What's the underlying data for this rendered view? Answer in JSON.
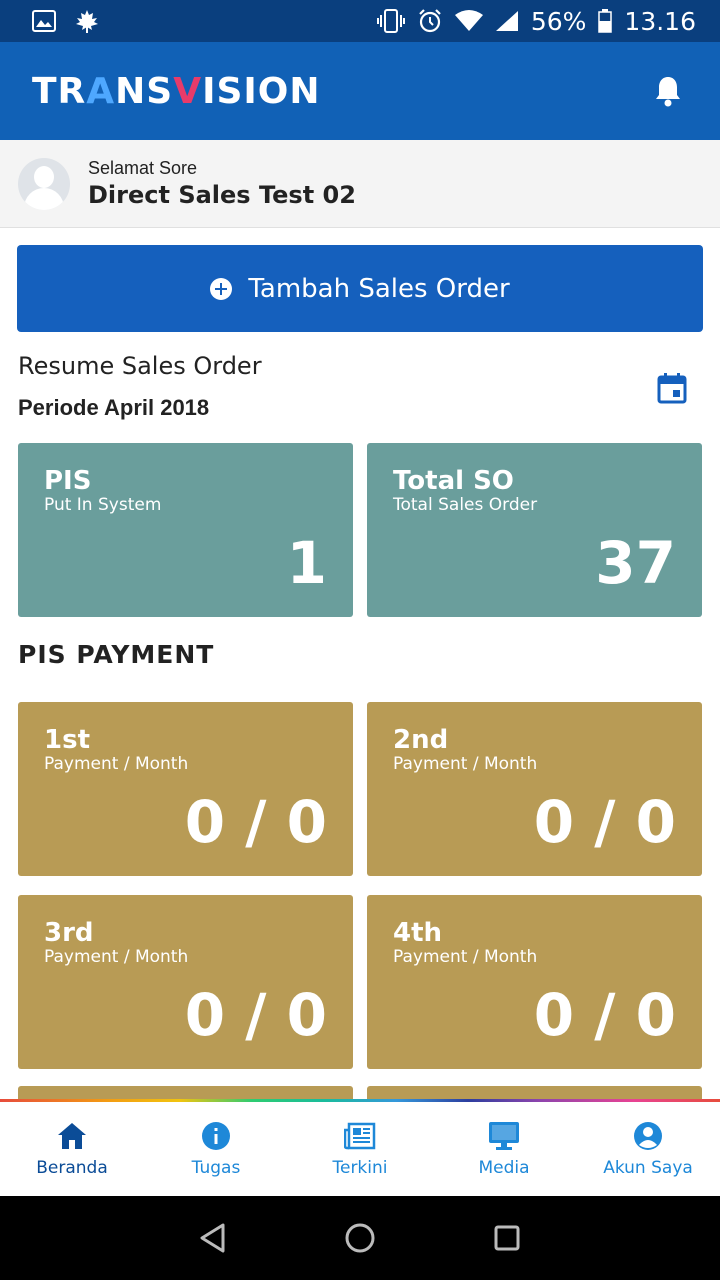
{
  "status_bar": {
    "battery": "56%",
    "time": "13.16"
  },
  "app_bar": {
    "logo": {
      "part1": "TR",
      "part2": "A",
      "part3": "NS",
      "part4": "V",
      "part5": "ISION"
    },
    "icon": "bell-icon"
  },
  "greeting": {
    "salutation": "Selamat Sore",
    "name": "Direct Sales Test 02"
  },
  "add_button": {
    "label": "Tambah Sales Order"
  },
  "resume": {
    "title": "Resume Sales Order",
    "periode": "Periode April 2018"
  },
  "summary_cards": [
    {
      "title": "PIS",
      "subtitle": "Put In System",
      "value": "1"
    },
    {
      "title": "Total SO",
      "subtitle": "Total Sales Order",
      "value": "37"
    }
  ],
  "pis_payment": {
    "title": "PIS PAYMENT",
    "cards": [
      {
        "title": "1st",
        "subtitle": "Payment / Month",
        "value": "0 / 0"
      },
      {
        "title": "2nd",
        "subtitle": "Payment / Month",
        "value": "0 / 0"
      },
      {
        "title": "3rd",
        "subtitle": "Payment / Month",
        "value": "0 / 0"
      },
      {
        "title": "4th",
        "subtitle": "Payment / Month",
        "value": "0 / 0"
      }
    ]
  },
  "bottom_nav": [
    {
      "label": "Beranda",
      "icon": "home-icon",
      "active": true
    },
    {
      "label": "Tugas",
      "icon": "info-icon",
      "active": false
    },
    {
      "label": "Terkini",
      "icon": "newspaper-icon",
      "active": false
    },
    {
      "label": "Media",
      "icon": "monitor-icon",
      "active": false
    },
    {
      "label": "Akun Saya",
      "icon": "account-icon",
      "active": false
    }
  ],
  "colors": {
    "status_bar": "#0a3f7e",
    "app_bar": "#1161b6",
    "primary_button": "#1560bd",
    "teal_card": "#6a9e9c",
    "gold_card": "#b89b55",
    "nav_active": "#0b4c97",
    "nav_inactive": "#1e88d8"
  }
}
